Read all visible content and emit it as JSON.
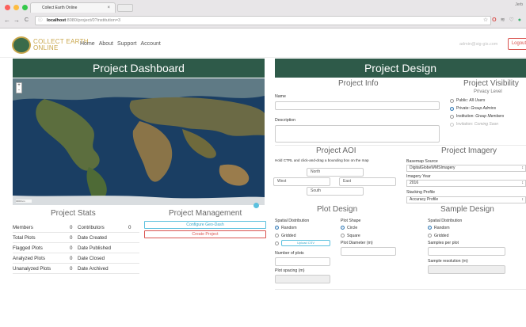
{
  "browser": {
    "tab_title": "Collect Earth Online",
    "tab_close": "×",
    "user_name": "Jerb",
    "url_host": "localhost",
    "url_path": ":8080/project/0?institution=3",
    "nav_back": "←",
    "nav_forward": "→",
    "nav_reload": "C",
    "nav_info": "ⓘ",
    "ext_star": "☆",
    "ext_adblock": "O",
    "ext_shield": "≋",
    "ext_heart": "♡",
    "ext_update": "●"
  },
  "app": {
    "logo_line1": "COLLECT EARTH",
    "logo_line2": "ONLINE",
    "menu": [
      "Home",
      "About",
      "Support",
      "Account"
    ],
    "admin_email": "admin@sig-gis.com",
    "logout_label": "Logout"
  },
  "dashboard": {
    "title": "Project Dashboard",
    "zoom_in": "+",
    "zoom_out": "-",
    "scale_text": "3000 km",
    "stats_title": "Project Stats",
    "stats_left": [
      {
        "label": "Members",
        "value": "0"
      },
      {
        "label": "Total Plots",
        "value": "0"
      },
      {
        "label": "Flagged Plots",
        "value": "0"
      },
      {
        "label": "Analyzed Plots",
        "value": "0"
      },
      {
        "label": "Unanalyzed Plots",
        "value": "0"
      }
    ],
    "stats_right": [
      {
        "label": "Contributors",
        "value": "0"
      },
      {
        "label": "Date Created",
        "value": ""
      },
      {
        "label": "Date Published",
        "value": ""
      },
      {
        "label": "Date Closed",
        "value": ""
      },
      {
        "label": "Date Archived",
        "value": ""
      }
    ],
    "mgmt_title": "Project Management",
    "configure_label": "Configure Geo-Dash",
    "create_label": "Create Project"
  },
  "design": {
    "title": "Project Design",
    "info_title": "Project Info",
    "name_label": "Name",
    "description_label": "Description",
    "visibility_title": "Project Visibility",
    "privacy_level": "Privacy Level",
    "visibility_options": [
      {
        "prefix": "Public:",
        "suffix": "All Users"
      },
      {
        "prefix": "Private:",
        "suffix": "Group Admins"
      },
      {
        "prefix": "Institution:",
        "suffix": "Group Members"
      },
      {
        "prefix": "Invitation:",
        "suffix": "Coming Soon"
      }
    ],
    "aoi_title": "Project AOI",
    "aoi_hint": "Hold CTRL and click-and-drag a bounding box on the map",
    "aoi_north": "North",
    "aoi_west": "West",
    "aoi_east": "East",
    "aoi_south": "South",
    "imagery_title": "Project Imagery",
    "basemap_label": "Basemap Source",
    "basemap_value": "DigitalGlobeWMSImagery",
    "year_label": "Imagery Year",
    "year_value": "2016",
    "stacking_label": "Stacking Profile",
    "stacking_value": "Accuracy Profile",
    "plot_title": "Plot Design",
    "spatial_dist_label": "Spatial Distribution",
    "plot_random": "Random",
    "plot_gridded": "Gridded",
    "upload_csv": "Upload CSV",
    "num_plots_label": "Number of plots",
    "plot_spacing_label": "Plot spacing (m)",
    "plot_shape_label": "Plot Shape",
    "shape_circle": "Circle",
    "shape_square": "Square",
    "plot_diameter_label": "Plot Diameter (m)",
    "sample_title": "Sample Design",
    "sample_dist_label": "Spatial Distribution",
    "sample_random": "Random",
    "sample_gridded": "Gridded",
    "samples_per_plot_label": "Samples per plot",
    "sample_resolution_label": "Sample resolution (m)"
  },
  "colors": {
    "header_green": "#2e5a49",
    "gold": "#c9a64a",
    "danger": "#d9534f",
    "info": "#5bc0de",
    "primary": "#337ab7"
  }
}
